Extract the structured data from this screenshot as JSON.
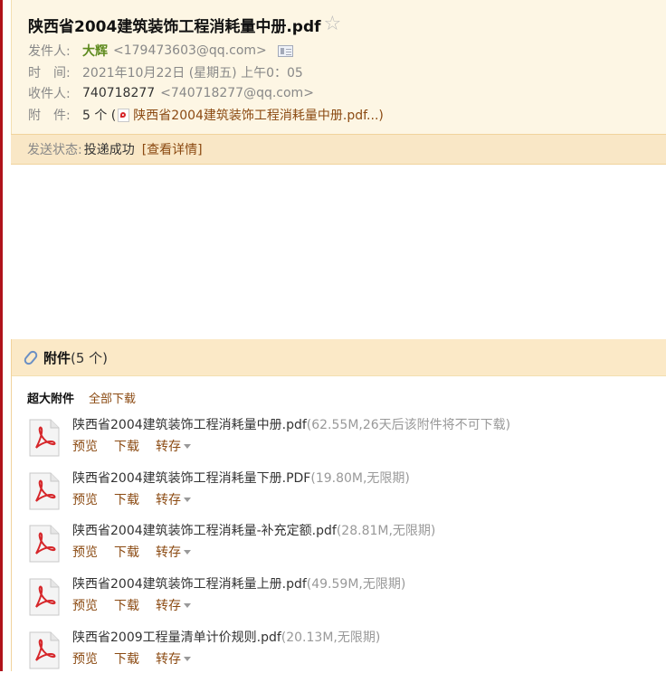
{
  "mail": {
    "subject": "陕西省2004建筑装饰工程消耗量中册.pdf",
    "star_icon": "star-icon",
    "from_label": "发件人:",
    "from_name": "大辉",
    "from_addr": "<179473603@qq.com>",
    "time_label": "时　间:",
    "time_value": "2021年10月22日 (星期五) 上午0：05",
    "to_label": "收件人:",
    "to_name": "740718277",
    "to_addr": "<740718277@qq.com>",
    "att_label": "附　件:",
    "att_count": "5 个 (",
    "att_first": "陕西省2004建筑装饰工程消耗量中册.pdf...)",
    "status_label": "发送状态:",
    "status_value": "投递成功",
    "status_link": "[查看详情]"
  },
  "attachments": {
    "title": "附件",
    "count": "(5 个)",
    "super_title": "超大附件",
    "download_all": "全部下载",
    "actions": {
      "preview": "预览",
      "download": "下载",
      "forward": "转存"
    },
    "files": [
      {
        "name": "陕西省2004建筑装饰工程消耗量中册.pdf",
        "meta": "(62.55M,26天后该附件将不可下载)"
      },
      {
        "name": "陕西省2004建筑装饰工程消耗量下册.PDF",
        "meta": "(19.80M,无限期)"
      },
      {
        "name": "陕西省2004建筑装饰工程消耗量-补充定额.pdf",
        "meta": "(28.81M,无限期)"
      },
      {
        "name": "陕西省2004建筑装饰工程消耗量上册.pdf",
        "meta": "(49.59M,无限期)"
      },
      {
        "name": "陕西省2009工程量清单计价规则.pdf",
        "meta": "(20.13M,无限期)"
      }
    ]
  },
  "colors": {
    "accent_link": "#8b4a12",
    "header_bg": "#fdf6e4",
    "status_bg": "#f9e7c6",
    "pdf_red": "#d6262a"
  }
}
